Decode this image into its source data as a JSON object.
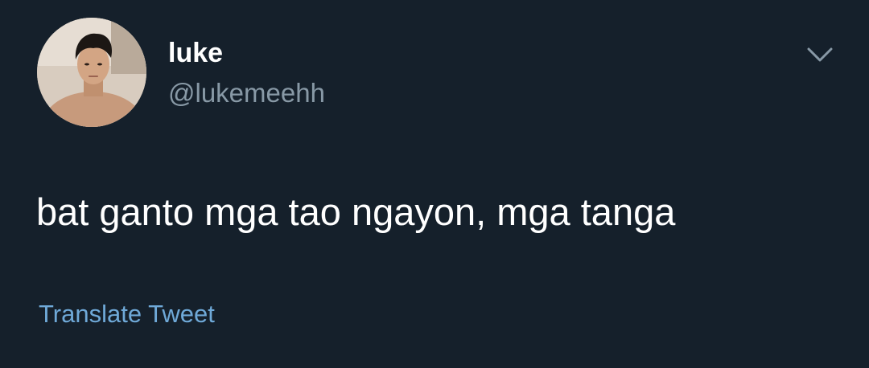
{
  "colors": {
    "background": "#15202b",
    "primary_text": "#ffffff",
    "secondary_text": "#8899a6",
    "link": "#6fa9d8"
  },
  "author": {
    "display_name": "luke",
    "handle": "@lukemeehh",
    "avatar_icon": "profile-photo"
  },
  "menu": {
    "icon": "chevron-down-icon"
  },
  "tweet": {
    "text": "bat ganto mga tao ngayon, mga tanga",
    "translate_label": "Translate Tweet"
  }
}
